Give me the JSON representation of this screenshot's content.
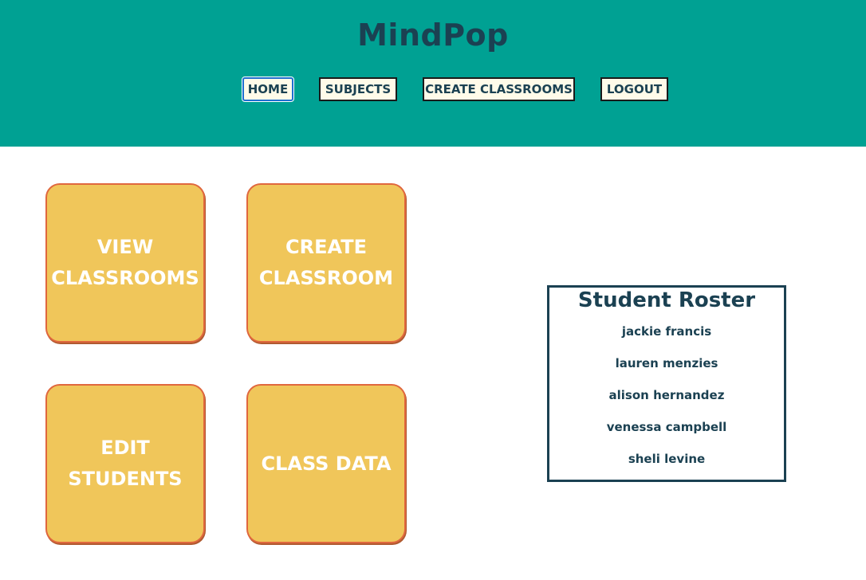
{
  "header": {
    "title": "MindPop",
    "nav": [
      {
        "label": "HOME"
      },
      {
        "label": "SUBJECTS"
      },
      {
        "label": "CREATE CLASSROOMS"
      },
      {
        "label": "LOGOUT"
      }
    ],
    "background_color": "#00a193"
  },
  "tiles": [
    {
      "label": "VIEW CLASSROOMS"
    },
    {
      "label": "CREATE CLASSROOM"
    },
    {
      "label": "EDIT STUDENTS"
    },
    {
      "label": "CLASS DATA"
    }
  ],
  "roster": {
    "title": "Student Roster",
    "students": [
      "jackie francis",
      "lauren menzies",
      "alison hernandez",
      "venessa campbell",
      "sheli levine"
    ]
  },
  "colors": {
    "tile": "#f0c65a",
    "tile_border": "#e0673e",
    "text_dark": "#1b4152"
  }
}
